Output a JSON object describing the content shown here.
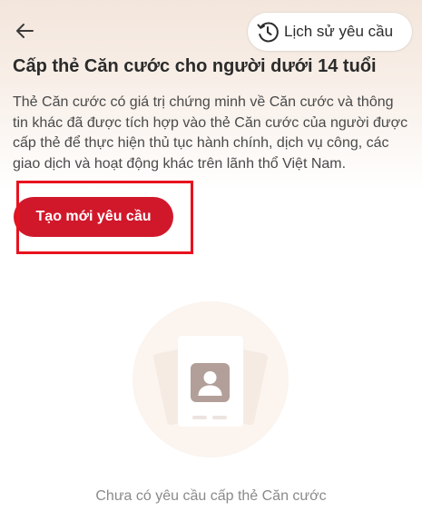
{
  "header": {
    "back_icon": "arrow-left-icon",
    "history_icon": "clock-history-icon",
    "history_label": "Lịch sử yêu cầu",
    "title": "Cấp thẻ Căn cước cho người dưới 14 tuổi"
  },
  "description": "Thẻ Căn cước có giá trị chứng minh về Căn cước và thông tin khác đã được tích hợp vào thẻ Căn cước của người được cấp thẻ để thực hiện thủ tục hành chính, dịch vụ công, các giao dịch và hoạt động khác trên lãnh thổ Việt Nam.",
  "actions": {
    "create_label": "Tạo mới yêu cầu"
  },
  "empty_state": {
    "icon": "id-card-icon",
    "message": "Chưa có yêu cầu cấp thẻ Căn cước"
  },
  "colors": {
    "primary": "#d1182b",
    "highlight": "#e8121f",
    "header_gradient_top": "#f3e6dc"
  }
}
